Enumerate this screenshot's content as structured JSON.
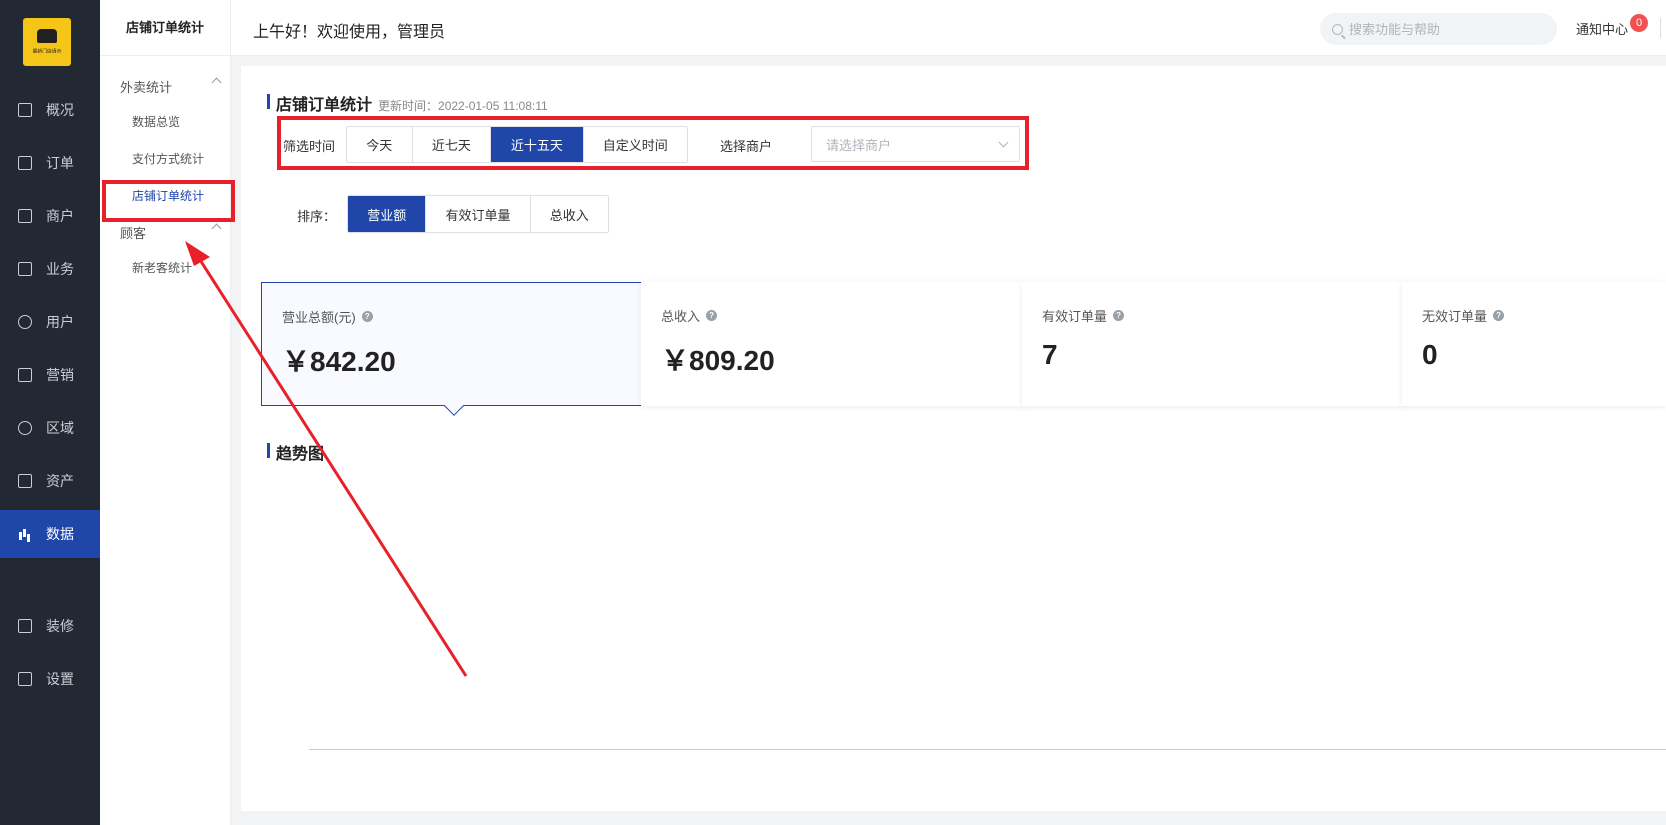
{
  "logo": {
    "text": "最新门店请示"
  },
  "rail": {
    "items": [
      {
        "label": "概况",
        "icon": "dashboard-icon"
      },
      {
        "label": "订单",
        "icon": "order-icon"
      },
      {
        "label": "商户",
        "icon": "merchant-icon"
      },
      {
        "label": "业务",
        "icon": "business-icon"
      },
      {
        "label": "用户",
        "icon": "user-icon"
      },
      {
        "label": "营销",
        "icon": "marketing-icon"
      },
      {
        "label": "区域",
        "icon": "region-icon"
      },
      {
        "label": "资产",
        "icon": "asset-icon"
      },
      {
        "label": "数据",
        "icon": "bar-chart-icon",
        "active": true
      },
      {
        "label": "装修",
        "icon": "decorate-icon"
      },
      {
        "label": "设置",
        "icon": "settings-icon"
      }
    ]
  },
  "subside": {
    "title": "店铺订单统计",
    "groups": [
      {
        "label": "外卖统计",
        "links": [
          "数据总览",
          "支付方式统计",
          "店铺订单统计"
        ]
      },
      {
        "label": "顾客",
        "links": [
          "新老客统计"
        ]
      }
    ],
    "active_link": "店铺订单统计"
  },
  "topbar": {
    "greeting": "上午好！欢迎使用，管理员",
    "search_placeholder": "搜索功能与帮助",
    "notify_label": "通知中心",
    "notify_count": "0"
  },
  "main": {
    "title": "店铺订单统计",
    "update_label": "更新时间：2022-01-05 11:08:11",
    "filter_time_label": "筛选时间",
    "time_options": [
      "今天",
      "近七天",
      "近十五天",
      "自定义时间"
    ],
    "time_selected": "近十五天",
    "merchant_label": "选择商户",
    "merchant_placeholder": "请选择商户",
    "sort_label": "排序：",
    "sort_options": [
      "营业额",
      "有效订单量",
      "总收入"
    ],
    "sort_selected": "营业额",
    "cards": [
      {
        "label": "营业总额(元)",
        "value": "￥842.20"
      },
      {
        "label": "总收入",
        "value": "￥809.20"
      },
      {
        "label": "有效订单量",
        "value": "7"
      },
      {
        "label": "无效订单量",
        "value": "0"
      }
    ],
    "trend_title": "趋势图"
  },
  "colors": {
    "primary": "#1f46a8",
    "rail_bg": "#222933",
    "annotation_red": "#e8202a",
    "badge_red": "#f05252"
  }
}
